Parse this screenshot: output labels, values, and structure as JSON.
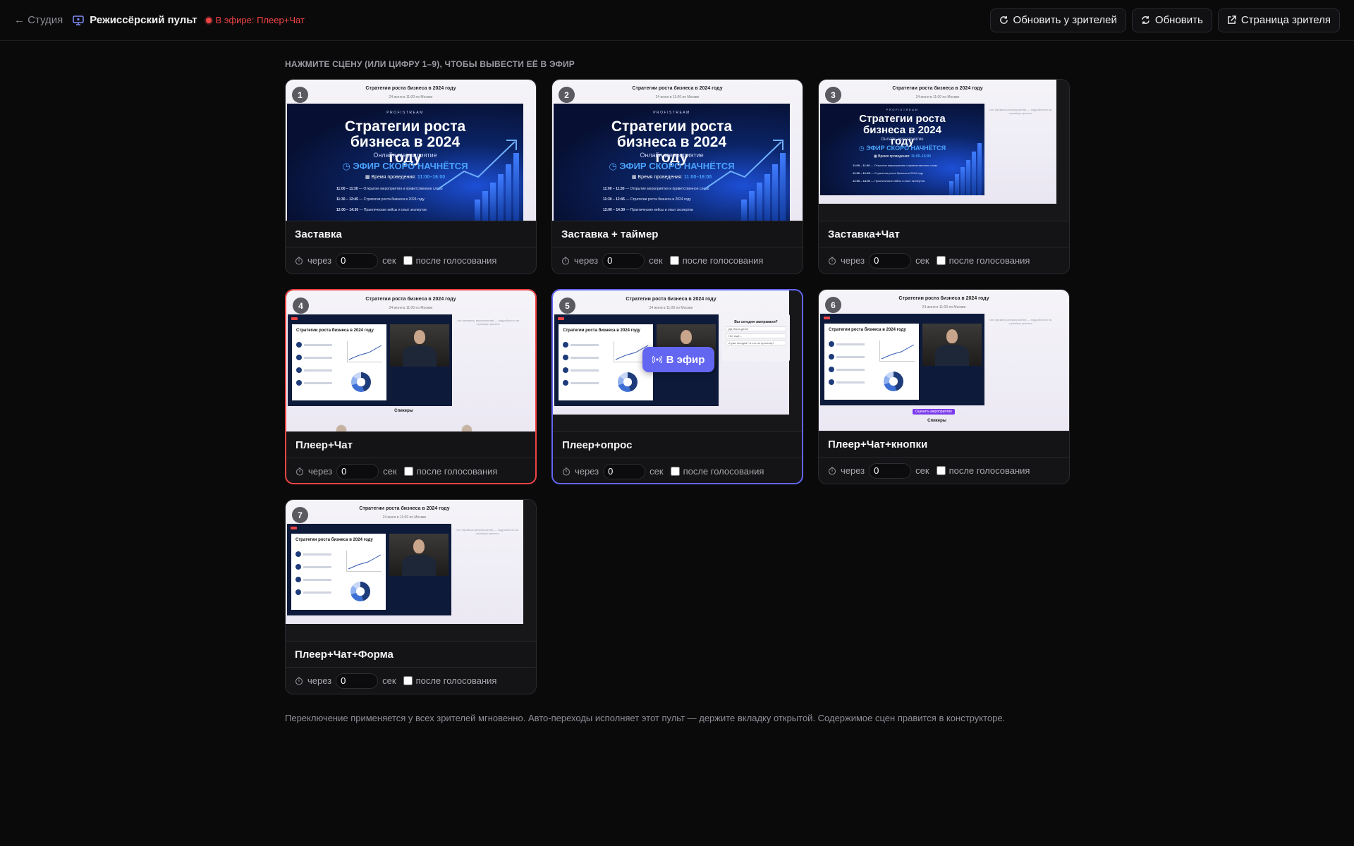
{
  "header": {
    "back_label": "← Студия",
    "title": "Режиссёрский пульт",
    "live_status": "В эфире: Плеер+Чат",
    "actions": {
      "refresh_viewers": "Обновить у зрителей",
      "refresh": "Обновить",
      "viewer_page": "Страница зрителя"
    }
  },
  "instruction": "Нажмите сцену (или цифру 1–9), чтобы вывести её в эфир",
  "labels": {
    "delay_prefix": "через",
    "delay_unit": "сек",
    "after_vote": "после голосования",
    "go_live": "В эфир"
  },
  "preview": {
    "event_title": "Стратегии роста бизнеса в 2024 году",
    "event_date": "24 июня в 11:00 по Москве",
    "brand": "PROFISTREAM",
    "poster_heading": "Стратегии роста бизнеса в 2024 году",
    "poster_online": "Онлайн-мероприятие",
    "poster_soon": "ЭФИР СКОРО НАЧНЁТСЯ",
    "poster_time_label": "Время проведения:",
    "poster_time_value": "11:00–16:00",
    "schedule": [
      {
        "time": "11:00 – 11:30",
        "text": "Открытие мероприятия и приветственное слово"
      },
      {
        "time": "11:30 – 12:45",
        "text": "Стратегии роста бизнеса в 2024 году"
      },
      {
        "time": "12:00 – 14:30",
        "text": "Практические кейсы и опыт экспертов"
      }
    ],
    "slide_title": "Стратегии роста бизнеса в 2024 году",
    "chat_hint": "Чат (примеры мероприятия) — подробности на странице зрителя",
    "poll_question": "Вы сегодня завтракали?",
    "poll_options": [
      "Да, было дело!",
      "Нет ещё...",
      "А уже сегодня? А что по прогнозу?"
    ],
    "speakers": "Спикеры",
    "rate_button": "Оценить мероприятие"
  },
  "scenes": [
    {
      "number": "1",
      "name": "Заставка",
      "delay": "0",
      "after_vote": false
    },
    {
      "number": "2",
      "name": "Заставка + таймер",
      "delay": "0",
      "after_vote": false
    },
    {
      "number": "3",
      "name": "Заставка+Чат",
      "delay": "0",
      "after_vote": false
    },
    {
      "number": "4",
      "name": "Плеер+Чат",
      "delay": "0",
      "after_vote": false,
      "state": "live"
    },
    {
      "number": "5",
      "name": "Плеер+опрос",
      "delay": "0",
      "after_vote": false,
      "state": "selected"
    },
    {
      "number": "6",
      "name": "Плеер+Чат+кнопки",
      "delay": "0",
      "after_vote": false
    },
    {
      "number": "7",
      "name": "Плеер+Чат+Форма",
      "delay": "0",
      "after_vote": false
    }
  ],
  "footnote": "Переключение применяется у всех зрителей мгновенно. Авто-переходы исполняет этот пульт — держите вкладку открытой. Содержимое сцен правится в конструкторе.",
  "colors": {
    "live": "#ef4444",
    "selected": "#6366f1",
    "background": "#0a0a0b"
  },
  "icons": [
    "monitor-icon",
    "refresh-icon",
    "external-link-icon",
    "timer-icon",
    "broadcast-icon"
  ]
}
